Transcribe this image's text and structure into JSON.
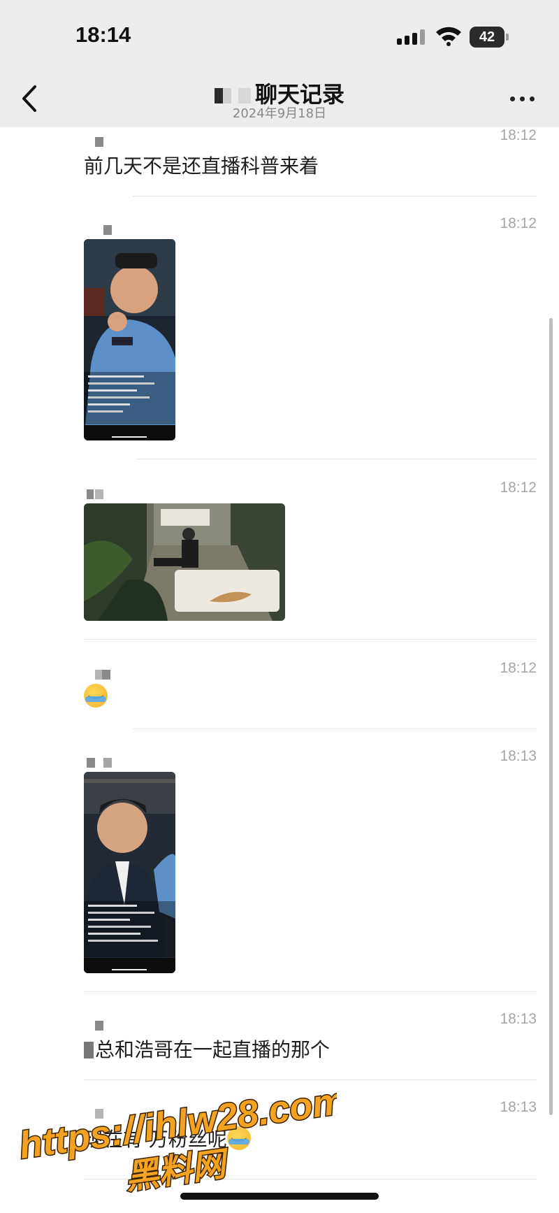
{
  "status_bar": {
    "time": "18:14",
    "battery": "42"
  },
  "header": {
    "title": "聊天记录",
    "subtitle": "2024年9月18日"
  },
  "messages": [
    {
      "time": "18:12",
      "text": "前几天不是还直播科普来着"
    },
    {
      "time": "18:12",
      "media": "video",
      "description_icon": "video-thumbnail"
    },
    {
      "time": "18:12",
      "media": "photo"
    },
    {
      "time": "18:12",
      "text": ""
    },
    {
      "time": "18:13",
      "media": "video"
    },
    {
      "time": "18:13",
      "text": "总和浩哥在一起直播的那个"
    },
    {
      "time": "18:13",
      "text": "现在有   万粉丝呢"
    }
  ],
  "watermark": {
    "url": "https://ihlw28.com",
    "name": "黑料网"
  },
  "colors": {
    "header_bg": "#ededed",
    "time_gray": "#a6a6a6",
    "watermark_orange": "#f3a221"
  }
}
